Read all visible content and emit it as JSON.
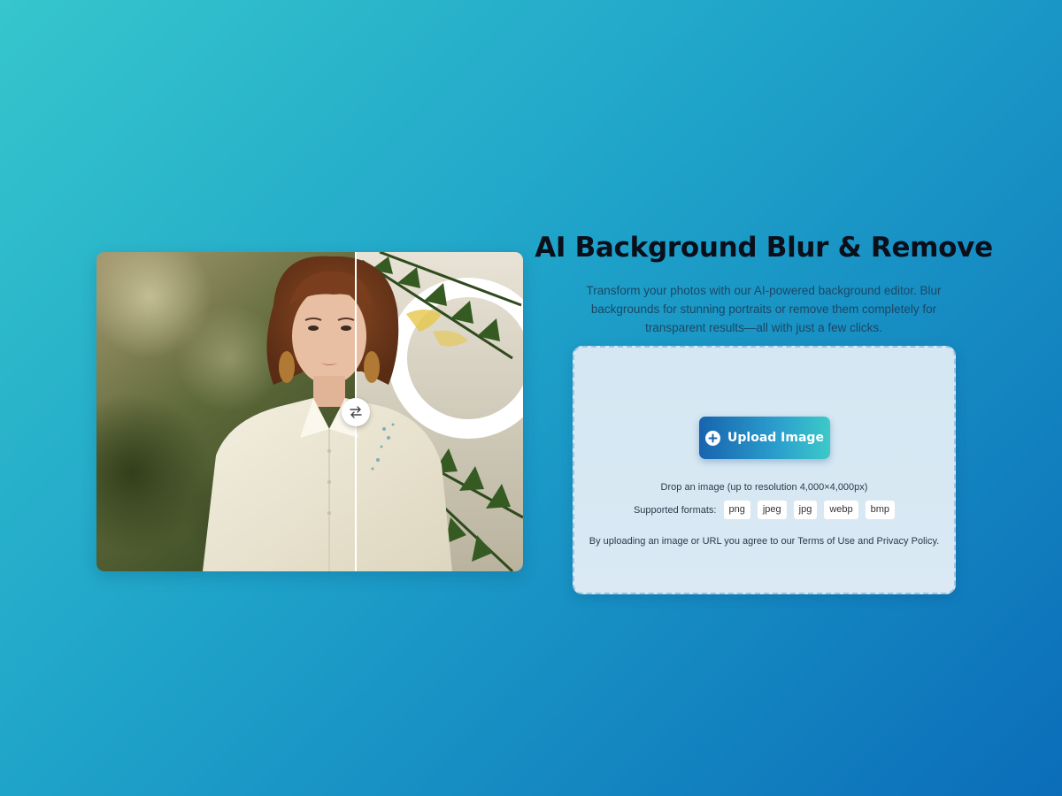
{
  "hero": {
    "title": "AI Background Blur & Remove",
    "description": "Transform your photos with our AI-powered background editor. Blur backgrounds for stunning portraits or remove them completely for transparent results—all with just a few clicks."
  },
  "comparison": {
    "handle_icon": "swap-arrows-icon"
  },
  "upload": {
    "button_label": "Upload Image",
    "button_icon": "plus-circle-icon",
    "drop_text": "Drop an image (up to resolution 4,000×4,000px)",
    "formats_label": "Supported formats:",
    "formats": [
      "png",
      "jpeg",
      "jpg",
      "webp",
      "bmp"
    ],
    "agree_prefix": "By uploading an image or URL you agree to our ",
    "terms_link": "Terms of Use",
    "agree_and": " and ",
    "privacy_link": "Privacy Policy",
    "agree_suffix": "."
  },
  "colors": {
    "bg_start": "#36c6cc",
    "bg_end": "#0b6db9",
    "button_start": "#1764ae",
    "button_end": "#3ccac8",
    "title": "#0a0f1a"
  }
}
